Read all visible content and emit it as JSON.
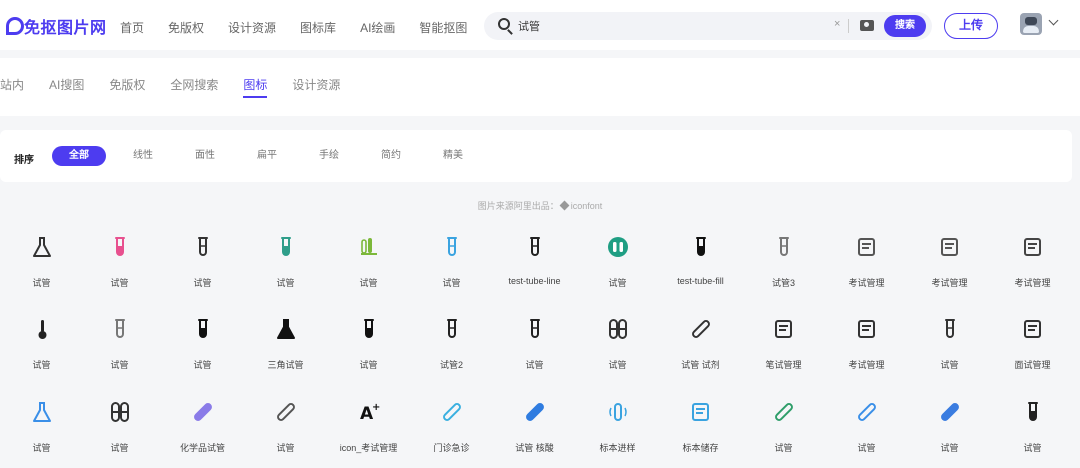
{
  "header": {
    "logo_text": "免抠图片网",
    "nav": [
      "首页",
      "免版权",
      "设计资源",
      "图标库",
      "AI绘画",
      "智能抠图"
    ],
    "search": {
      "value": "试管",
      "clear": "×",
      "button": "搜索"
    },
    "upload": "上传"
  },
  "tabs": {
    "items": [
      "站内",
      "AI搜图",
      "免版权",
      "全网搜索",
      "图标",
      "设计资源"
    ],
    "active": "图标"
  },
  "filter": {
    "label": "排序",
    "chips": [
      "全部",
      "线性",
      "面性",
      "扁平",
      "手绘",
      "简约",
      "精美"
    ],
    "active": "全部"
  },
  "source": {
    "prefix": "图片来源阿里出品：",
    "name": "iconfont"
  },
  "rows": [
    [
      {
        "label": "试管",
        "icon": "beaker-tilted-icon",
        "color": "#333333"
      },
      {
        "label": "试管",
        "icon": "test-tube-pink-icon",
        "color": "#e8508f"
      },
      {
        "label": "试管",
        "icon": "test-tube-icon",
        "color": "#333333"
      },
      {
        "label": "试管",
        "icon": "test-tube-teal-icon",
        "color": "#2f9e8a"
      },
      {
        "label": "试管",
        "icon": "test-tube-rack-icon",
        "color": "#7cb83a"
      },
      {
        "label": "试管",
        "icon": "test-tube-blue-icon",
        "color": "#3aa3e0"
      },
      {
        "label": "test-tube-line",
        "icon": "test-tube-line-icon",
        "color": "#222222"
      },
      {
        "label": "试管",
        "icon": "tube-circle-icon",
        "color": "#1f9e83"
      },
      {
        "label": "test-tube-fill",
        "icon": "test-tube-fill-icon",
        "color": "#111111"
      },
      {
        "label": "试管3",
        "icon": "test-tube-outline-icon",
        "color": "#777777"
      },
      {
        "label": "考试管理",
        "icon": "exam-stack-icon",
        "color": "#555555"
      },
      {
        "label": "考试管理",
        "icon": "exam-stack-small-icon",
        "color": "#555555"
      },
      {
        "label": "考试管理",
        "icon": "exam-people-gear-icon",
        "color": "#444444"
      }
    ],
    [
      {
        "label": "试管",
        "icon": "thermometer-icon",
        "color": "#222222"
      },
      {
        "label": "试管",
        "icon": "test-tube-thin-icon",
        "color": "#777777"
      },
      {
        "label": "试管",
        "icon": "test-tube-bold-icon",
        "color": "#111111"
      },
      {
        "label": "三角试管",
        "icon": "flask-triangle-icon",
        "color": "#111111"
      },
      {
        "label": "试管",
        "icon": "test-tube-bold-icon",
        "color": "#111111"
      },
      {
        "label": "试管2",
        "icon": "test-tube-small-icon",
        "color": "#222222"
      },
      {
        "label": "试管",
        "icon": "test-tube-line-icon",
        "color": "#222222"
      },
      {
        "label": "试管",
        "icon": "double-tube-icon",
        "color": "#333333"
      },
      {
        "label": "试管 试剂",
        "icon": "pipette-icon",
        "color": "#333333"
      },
      {
        "label": "笔试管理",
        "icon": "exam-pen-icon",
        "color": "#333333"
      },
      {
        "label": "考试管理",
        "icon": "exam-book-icon",
        "color": "#333333"
      },
      {
        "label": "试管",
        "icon": "flask-tube-icon",
        "color": "#333333"
      },
      {
        "label": "面试管理",
        "icon": "interview-icon",
        "color": "#333333"
      }
    ],
    [
      {
        "label": "试管",
        "icon": "flask-blue-icon",
        "color": "#3a8fe8"
      },
      {
        "label": "试管",
        "icon": "tube-pair-icon",
        "color": "#333333"
      },
      {
        "label": "化学品试管",
        "icon": "chemical-tube-icon",
        "color": "#8a7be8"
      },
      {
        "label": "试管",
        "icon": "pipette-outline-icon",
        "color": "#555555"
      },
      {
        "label": "icon_考试管理",
        "icon": "a-plus-icon",
        "color": "#111111"
      },
      {
        "label": "门诊急诊",
        "icon": "emergency-tube-icon",
        "color": "#3ab0e0"
      },
      {
        "label": "试管 核酸",
        "icon": "nucleic-tube-icon",
        "color": "#2f7ce0"
      },
      {
        "label": "标本进样",
        "icon": "sample-inject-icon",
        "color": "#3aa3e0"
      },
      {
        "label": "标本储存",
        "icon": "sample-store-icon",
        "color": "#3aa3e0"
      },
      {
        "label": "试管",
        "icon": "pipette-green-icon",
        "color": "#2f9e6a"
      },
      {
        "label": "试管",
        "icon": "pipette-blue-outline-icon",
        "color": "#3a8fe8"
      },
      {
        "label": "试管",
        "icon": "pipette-blue-fill-icon",
        "color": "#3a7ce0"
      },
      {
        "label": "试管",
        "icon": "test-tube-bold-icon",
        "color": "#222222"
      }
    ]
  ]
}
